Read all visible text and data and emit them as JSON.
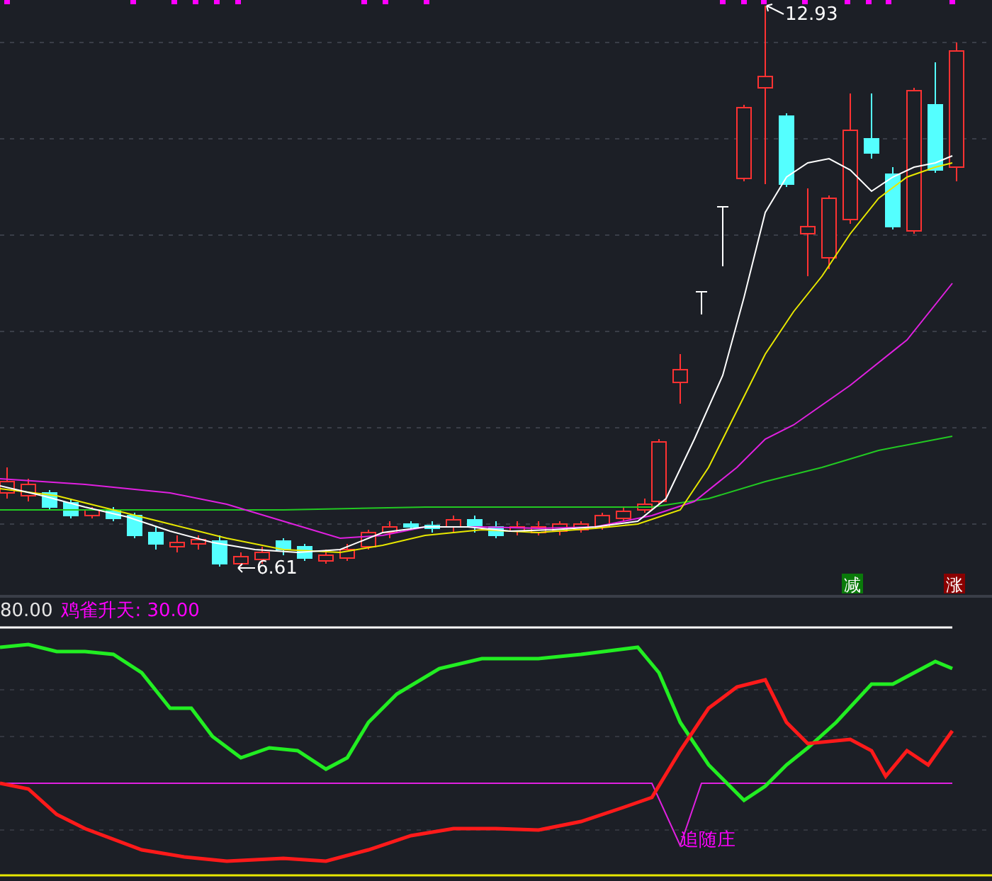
{
  "price_chart": {
    "high_label": "12.93",
    "low_label": "6.61",
    "badges": [
      {
        "text": "减",
        "kind": "decrease"
      },
      {
        "text": "涨",
        "kind": "increase"
      }
    ]
  },
  "indicator": {
    "legend": [
      {
        "text": "80.00",
        "color": "#e6e6e6"
      },
      {
        "text": "鸡雀升天: 30.00",
        "color": "#ff00ff"
      }
    ],
    "line_label": "追随庄"
  }
}
